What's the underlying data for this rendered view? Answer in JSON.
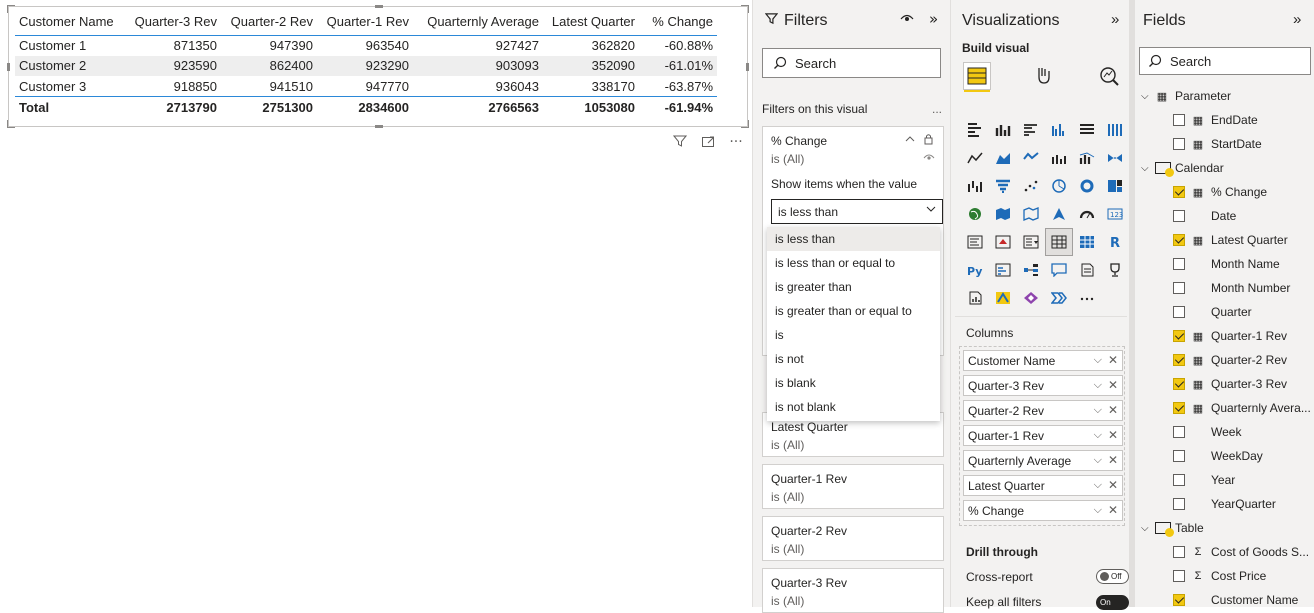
{
  "table": {
    "headers": [
      "Customer Name",
      "Quarter-3 Rev",
      "Quarter-2 Rev",
      "Quarter-1 Rev",
      "Quarternly Average",
      "Latest Quarter",
      "% Change"
    ],
    "rows": [
      [
        "Customer 1",
        "871350",
        "947390",
        "963540",
        "927427",
        "362820",
        "-60.88%"
      ],
      [
        "Customer 2",
        "923590",
        "862400",
        "923290",
        "903093",
        "352090",
        "-61.01%"
      ],
      [
        "Customer 3",
        "918850",
        "941510",
        "947770",
        "936043",
        "338170",
        "-63.87%"
      ]
    ],
    "total": [
      "Total",
      "2713790",
      "2751300",
      "2834600",
      "2766563",
      "1053080",
      "-61.94%"
    ]
  },
  "visual_header": {
    "filter_icon": "filter-icon",
    "focus_icon": "focus-mode-icon",
    "more": "···"
  },
  "filters": {
    "title": "Filters",
    "search_placeholder": "Search",
    "section_label": "Filters on this visual",
    "more": "...",
    "pct_card": {
      "name": "% Change",
      "state": "is (All)",
      "show_label": "Show items when the value",
      "selected_condition": "is less than"
    },
    "dropdown_options": [
      "is less than",
      "is less than or equal to",
      "is greater than",
      "is greater than or equal to",
      "is",
      "is not",
      "is blank",
      "is not blank"
    ],
    "cards": [
      {
        "name": "Latest Quarter",
        "state": "is (All)"
      },
      {
        "name": "Quarter-1 Rev",
        "state": "is (All)"
      },
      {
        "name": "Quarter-2 Rev",
        "state": "is (All)"
      },
      {
        "name": "Quarter-3 Rev",
        "state": "is (All)"
      }
    ]
  },
  "visualizations": {
    "title": "Visualizations",
    "build_label": "Build visual",
    "columns_label": "Columns",
    "wells": [
      "Customer Name",
      "Quarter-3 Rev",
      "Quarter-2 Rev",
      "Quarter-1 Rev",
      "Quarternly Average",
      "Latest Quarter",
      "% Change"
    ],
    "drill_label": "Drill through",
    "cross_report_label": "Cross-report",
    "cross_report_state": "Off",
    "keep_filters_label": "Keep all filters",
    "keep_filters_state": "On"
  },
  "fields": {
    "title": "Fields",
    "search_placeholder": "Search",
    "tables": [
      {
        "name": "Parameter",
        "checked": false,
        "fields": [
          {
            "name": "EndDate",
            "checked": false,
            "icon": "calc"
          },
          {
            "name": "StartDate",
            "checked": false,
            "icon": "calc"
          }
        ]
      },
      {
        "name": "Calendar",
        "checked": true,
        "fields": [
          {
            "name": "% Change",
            "checked": true,
            "icon": "calc"
          },
          {
            "name": "Date",
            "checked": false,
            "icon": ""
          },
          {
            "name": "Latest Quarter",
            "checked": true,
            "icon": "calc"
          },
          {
            "name": "Month Name",
            "checked": false,
            "icon": ""
          },
          {
            "name": "Month Number",
            "checked": false,
            "icon": ""
          },
          {
            "name": "Quarter",
            "checked": false,
            "icon": ""
          },
          {
            "name": "Quarter-1 Rev",
            "checked": true,
            "icon": "calc"
          },
          {
            "name": "Quarter-2 Rev",
            "checked": true,
            "icon": "calc"
          },
          {
            "name": "Quarter-3 Rev",
            "checked": true,
            "icon": "calc"
          },
          {
            "name": "Quarternly Avera...",
            "checked": true,
            "icon": "calc"
          },
          {
            "name": "Week",
            "checked": false,
            "icon": ""
          },
          {
            "name": "WeekDay",
            "checked": false,
            "icon": ""
          },
          {
            "name": "Year",
            "checked": false,
            "icon": ""
          },
          {
            "name": "YearQuarter",
            "checked": false,
            "icon": ""
          }
        ]
      },
      {
        "name": "Table",
        "checked": true,
        "fields": [
          {
            "name": "Cost of Goods S...",
            "checked": false,
            "icon": "sigma"
          },
          {
            "name": "Cost Price",
            "checked": false,
            "icon": "sigma"
          },
          {
            "name": "Customer Name",
            "checked": true,
            "icon": ""
          }
        ]
      }
    ]
  },
  "colors": {
    "accent": "#f2c811",
    "selection_blue": "#2b88d8",
    "pane_bg": "#f3f2f1"
  }
}
